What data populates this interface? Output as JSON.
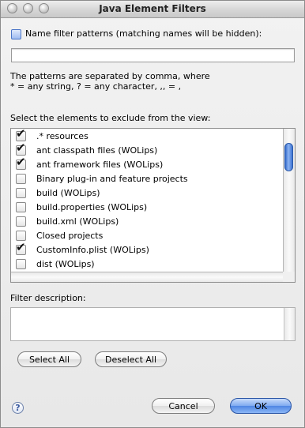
{
  "window": {
    "title": "Java Element Filters"
  },
  "name_filter": {
    "checkbox_label": "Name filter patterns (matching names will be hidden):",
    "checked": false,
    "input_value": ""
  },
  "hint": {
    "line1": "The patterns are separated by comma, where",
    "line2": "* = any string, ? = any character, ,, = ,"
  },
  "elements": {
    "heading": "Select the elements to exclude from the view:",
    "items": [
      {
        "label": ".* resources",
        "checked": true
      },
      {
        "label": "ant classpath files (WOLips)",
        "checked": true
      },
      {
        "label": "ant framework files (WOLips)",
        "checked": true
      },
      {
        "label": "Binary plug-in and feature projects",
        "checked": false
      },
      {
        "label": "build (WOLips)",
        "checked": false
      },
      {
        "label": "build.properties (WOLips)",
        "checked": false
      },
      {
        "label": "build.xml (WOLips)",
        "checked": false
      },
      {
        "label": "Closed projects",
        "checked": false
      },
      {
        "label": "CustomInfo.plist (WOLips)",
        "checked": true
      },
      {
        "label": "dist (WOLips)",
        "checked": false
      }
    ]
  },
  "filter_description": {
    "label": "Filter description:",
    "value": ""
  },
  "buttons": {
    "select_all": "Select All",
    "deselect_all": "Deselect All",
    "cancel": "Cancel",
    "ok": "OK",
    "help": "?"
  },
  "icons": {
    "check": "✔",
    "close": "close-icon",
    "minimize": "minimize-icon",
    "zoom": "zoom-icon",
    "help": "help-icon"
  },
  "colors": {
    "accent": "#4f86e3"
  }
}
